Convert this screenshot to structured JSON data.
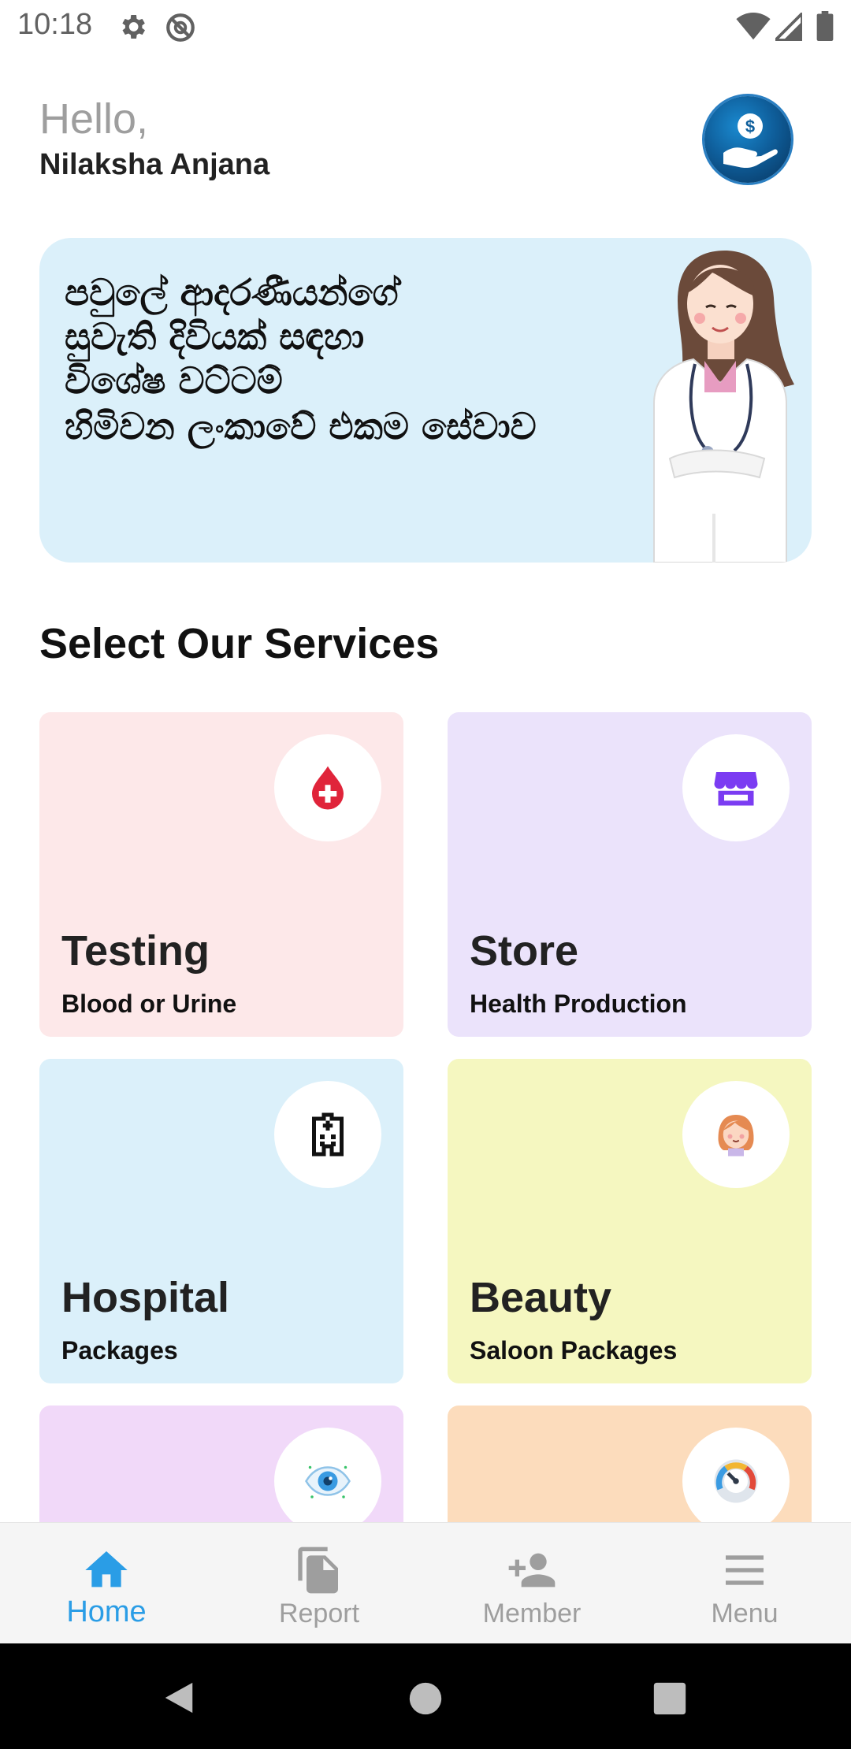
{
  "status_bar": {
    "time": "10:18",
    "icons": [
      "settings-icon",
      "do-not-disturb-icon",
      "wifi-icon",
      "signal-icon",
      "battery-icon"
    ]
  },
  "header": {
    "greeting": "Hello,",
    "user_name": "Nilaksha Anjana",
    "avatar_icon": "money-hand-icon"
  },
  "banner": {
    "lines": [
      "පවුලේ ආදරණීයන්ගේ",
      "සුවැති දිවියක් සඳහා",
      "විශේෂ වට්ටම්",
      "හිමිවන ලංකාවේ එකම සේවාව"
    ],
    "illustration": "doctor-illustration",
    "background": "#dbf0fa"
  },
  "section_title": "Select Our Services",
  "services": [
    {
      "title": "Testing",
      "subtitle": "Blood or Urine",
      "icon": "blood-drop-icon",
      "color": "#fde8e9"
    },
    {
      "title": "Store",
      "subtitle": "Health Production",
      "icon": "store-icon",
      "color": "#ebe3fb"
    },
    {
      "title": "Hospital",
      "subtitle": "Packages",
      "icon": "hospital-icon",
      "color": "#dbf0fa"
    },
    {
      "title": "Beauty",
      "subtitle": "Saloon Packages",
      "icon": "woman-face-icon",
      "color": "#f5f7c0"
    },
    {
      "title": "",
      "subtitle": "",
      "icon": "eye-icon",
      "color": "#f1d9f9"
    },
    {
      "title": "",
      "subtitle": "",
      "icon": "gauge-icon",
      "color": "#fcdcbc"
    }
  ],
  "bottom_nav": {
    "items": [
      {
        "label": "Home",
        "icon": "home-icon",
        "active": true
      },
      {
        "label": "Report",
        "icon": "report-icon",
        "active": false
      },
      {
        "label": "Member",
        "icon": "add-member-icon",
        "active": false
      },
      {
        "label": "Menu",
        "icon": "menu-icon",
        "active": false
      }
    ]
  },
  "colors": {
    "accent": "#2a9de6",
    "inactive": "#9e9e9e"
  }
}
